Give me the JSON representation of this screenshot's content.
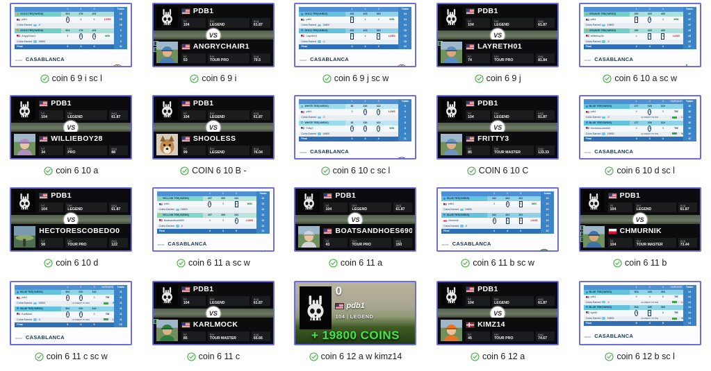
{
  "page": {
    "columns": 5,
    "rows": 4,
    "accent_border": "#6a6de2",
    "check_color": "#3aa93a"
  },
  "scorecard_common": {
    "room_label": "ROOM:",
    "room_name": "CASABLANCA",
    "prize_label": "PRIZE:",
    "prize_value": "19800",
    "final_label": "Final",
    "total_header": "Totals",
    "tee_label_suffix": "TEE(YARDS)",
    "coin_earned_label": "Coins Earned"
  },
  "cells": [
    {
      "id": "c1",
      "type": "scorecard",
      "caption": "coin 6 9 i sc l",
      "tee_color": "gold",
      "tee_name": "GOLD TEE(YARDS)",
      "holes": [
        "1",
        "2",
        "3",
        "4"
      ],
      "yardages": [
        "263",
        "278",
        "431"
      ],
      "total_header": "Totals",
      "rows": [
        {
          "player": "pdb1",
          "flag": "us",
          "scores": [
            "2",
            "4",
            "4"
          ],
          "marks": [
            "circ",
            "",
            ""
          ],
          "result": "LOSS",
          "total": "10",
          "coins": "-0"
        },
        {
          "player": "AngryChair1",
          "flag": "us",
          "scores": [
            "3",
            "3",
            "3"
          ],
          "marks": [
            "",
            "circ",
            "circ"
          ],
          "result": "WIN",
          "total": "9",
          "coins": "19800"
        }
      ],
      "par": [
        "3",
        "4",
        "4"
      ],
      "par_total": "11",
      "logo": "tree"
    },
    {
      "id": "c2",
      "type": "vs",
      "caption": "coin 6 9 i",
      "top": {
        "name": "PDB1",
        "flag": "us",
        "avatar": "skull",
        "stats": [
          {
            "k": "lvl",
            "v": "104"
          },
          {
            "k": "tier",
            "v": "LEGEND"
          },
          {
            "k": "avg",
            "v": "61.87"
          }
        ]
      },
      "bottom": {
        "name": "ANGRYCHAIR1",
        "flag": "us",
        "avatar": "golfer-blue",
        "badges": 2,
        "stats": [
          {
            "k": "lvl",
            "v": "53"
          },
          {
            "k": "tier",
            "v": "TOUR PRO"
          },
          {
            "k": "avg",
            "v": "79.5"
          }
        ]
      }
    },
    {
      "id": "c3",
      "type": "scorecard",
      "caption": "coin 6 9 j sc w",
      "tee_color": "blue",
      "tee_name": "GOLD TEE(YARDS)",
      "holes": [
        "1",
        "2",
        "3",
        "4"
      ],
      "yardages": [
        "432",
        "415",
        "369"
      ],
      "rows": [
        {
          "player": "pdb1",
          "flag": "us",
          "scores": [
            "5",
            "4",
            "4"
          ],
          "marks": [
            "sq",
            "",
            ""
          ],
          "result": "WIN",
          "total": "14",
          "coins": "19800"
        },
        {
          "player": "Layreth01",
          "flag": "us",
          "scores": [
            "5",
            "4",
            "6"
          ],
          "marks": [
            "sq",
            "",
            "sq"
          ],
          "result": "LOSS",
          "total": "15",
          "coins": "-0"
        }
      ],
      "par": [
        "4",
        "4",
        "4"
      ],
      "par_total": "12",
      "logo": "tree"
    },
    {
      "id": "c4",
      "type": "vs",
      "caption": "coin 6 9 j",
      "top": {
        "name": "PDB1",
        "flag": "us",
        "avatar": "skull",
        "stats": [
          {
            "k": "lvl",
            "v": "104"
          },
          {
            "k": "tier",
            "v": "LEGEND"
          },
          {
            "k": "avg",
            "v": "61.87"
          }
        ]
      },
      "bottom": {
        "name": "LAYRETH01",
        "flag": "us",
        "avatar": "golfer-cap",
        "badges": 1,
        "stats": [
          {
            "k": "lvl",
            "v": "74"
          },
          {
            "k": "tier",
            "v": "TOUR PRO"
          },
          {
            "k": "avg",
            "v": "81.84"
          }
        ]
      }
    },
    {
      "id": "c5",
      "type": "scorecard",
      "caption": "coin 6 10 a sc w",
      "tee_color": "orange",
      "tee_name": "ORANGE TEE(YARDS)",
      "holes": [
        "1",
        "2",
        "3",
        "4"
      ],
      "yardages": [
        "352",
        "425",
        "400"
      ],
      "rows": [
        {
          "player": "pdb1",
          "flag": "us",
          "scores": [
            "5",
            "3",
            "4"
          ],
          "marks": [
            "sq",
            "circ",
            ""
          ],
          "result": "WIN",
          "total": "12",
          "coins": "19800"
        },
        {
          "player": "WillieBoy28",
          "flag": "us",
          "scores": [
            "4",
            "6",
            "5"
          ],
          "marks": [
            "",
            "sq",
            "sq"
          ],
          "result": "LOSS",
          "total": "15",
          "coins": "-0"
        }
      ],
      "par": [
        "4",
        "4",
        "4"
      ],
      "par_total": "12",
      "logo": "pine"
    },
    {
      "id": "c6",
      "type": "vs",
      "caption": "coin 6 10 a",
      "top": {
        "name": "PDB1",
        "flag": "us",
        "avatar": "skull",
        "stats": [
          {
            "k": "lvl",
            "v": "104"
          },
          {
            "k": "tier",
            "v": "LEGEND"
          },
          {
            "k": "avg",
            "v": "61.87"
          }
        ]
      },
      "bottom": {
        "name": "WILLIEBOY28",
        "flag": "us",
        "avatar": "golfer-hat",
        "badges": 0,
        "stats": [
          {
            "k": "lvl",
            "v": "34"
          },
          {
            "k": "tier",
            "v": "PRO"
          },
          {
            "k": "avg",
            "v": "88"
          }
        ]
      }
    },
    {
      "id": "c7",
      "type": "vs",
      "caption": "COIN 6 10 B -",
      "top": {
        "name": "PDB1",
        "flag": "us",
        "avatar": "skull",
        "stats": [
          {
            "k": "lvl",
            "v": "104"
          },
          {
            "k": "tier",
            "v": "LEGEND"
          },
          {
            "k": "avg",
            "v": "61.87"
          }
        ]
      },
      "bottom": {
        "name": "SHOOLESS",
        "flag": "us",
        "avatar": "dog",
        "badges": 0,
        "stats": [
          {
            "k": "lvl",
            "v": "99"
          },
          {
            "k": "tier",
            "v": "LEGEND"
          },
          {
            "k": "avg",
            "v": "76.04"
          }
        ]
      }
    },
    {
      "id": "c8",
      "type": "scorecard",
      "caption": "coin 6 10 c sc l",
      "tee_color": "white",
      "tee_name": "WHITE TEE(YARDS)",
      "holes": [
        "1",
        "2",
        "3",
        "4"
      ],
      "yardages": [
        "36",
        "336",
        "422"
      ],
      "rows": [
        {
          "player": "pdb1",
          "flag": "us",
          "scores": [
            "3",
            "3",
            "3"
          ],
          "marks": [
            "",
            "circ",
            "circ"
          ],
          "result": "LOSS",
          "total": "9",
          "coins": "-0"
        },
        {
          "player": "Fritty3",
          "flag": "us",
          "scores": [
            "3",
            "3",
            "3"
          ],
          "marks": [
            "circ",
            "circ",
            "circ"
          ],
          "result": "WIN",
          "total": "8",
          "coins": "19800"
        }
      ],
      "par": [
        "3",
        "4",
        "4"
      ],
      "par_total": "11",
      "logo": "crossed"
    },
    {
      "id": "c9",
      "type": "vs",
      "caption": "COIN 6 10 C",
      "top": {
        "name": "PDB1",
        "flag": "us",
        "avatar": "skull",
        "stats": [
          {
            "k": "lvl",
            "v": "104"
          },
          {
            "k": "tier",
            "v": "LEGEND"
          },
          {
            "k": "avg",
            "v": "61.87"
          }
        ]
      },
      "bottom": {
        "name": "FRITTY3",
        "flag": "us",
        "avatar": "golfer-cap2",
        "badges": 0,
        "stats": [
          {
            "k": "lvl",
            "v": "85"
          },
          {
            "k": "tier",
            "v": "TOUR MASTER"
          },
          {
            "k": "avg",
            "v": "133.33"
          }
        ]
      }
    },
    {
      "id": "c10",
      "type": "scorecard",
      "caption": "coin 6 10 d sc l",
      "tee_color": "blue",
      "tee_name": "BLUE TEE(YARDS)",
      "holes": [
        "1",
        "2",
        "3",
        "4"
      ],
      "yardages": [
        "277",
        "300",
        "310"
      ],
      "yardage_header": "YARDAGE",
      "rows": [
        {
          "player": "pdb1",
          "flag": "us",
          "scores": [
            "4",
            "3",
            "3"
          ],
          "marks": [
            "",
            "circ",
            ""
          ],
          "result": "TIE",
          "total": "10",
          "coins": "-0",
          "dist": true,
          "dist_result": "LOSS"
        },
        {
          "player": "Hectorescobedo0",
          "flag": "us",
          "scores": [
            "4",
            "3",
            "3"
          ],
          "marks": [
            "",
            "circ",
            ""
          ],
          "result": "TIE",
          "total": "10",
          "coins": "19800",
          "dist": true,
          "dist_result": "WIN"
        }
      ],
      "par": [
        "4",
        "4",
        "3"
      ],
      "par_total": "11",
      "logo": "crest"
    },
    {
      "id": "c11",
      "type": "vs",
      "caption": "coin 6 10 d",
      "top": {
        "name": "PDB1",
        "flag": "us",
        "avatar": "skull",
        "stats": [
          {
            "k": "lvl",
            "v": "104"
          },
          {
            "k": "tier",
            "v": "LEGEND"
          },
          {
            "k": "avg",
            "v": "61.87"
          }
        ]
      },
      "bottom": {
        "name": "HECTORESCOBEDO0",
        "flag": "none",
        "avatar": "course",
        "badges": 0,
        "stats": [
          {
            "k": "lvl",
            "v": "58"
          },
          {
            "k": "tier",
            "v": "TOUR PRO"
          },
          {
            "k": "avg",
            "v": "122"
          }
        ]
      }
    },
    {
      "id": "c12",
      "type": "scorecard",
      "caption": "coin 6 11 a sc w",
      "tee_color": "yellow",
      "tee_name": "YELLOW TEE(YARDS)",
      "holes": [
        "1",
        "2",
        "3",
        "4"
      ],
      "yardages": [
        "407",
        "399",
        "344"
      ],
      "rows": [
        {
          "player": "pdb1",
          "flag": "us",
          "scores": [
            "3",
            "3",
            "6"
          ],
          "marks": [
            "circ",
            "",
            "sq"
          ],
          "result": "WIN",
          "total": "13",
          "coins": "19800"
        },
        {
          "player": "Boatsandhoes690",
          "flag": "us",
          "scores": [
            "4",
            "3",
            "4"
          ],
          "marks": [
            "",
            "",
            "circ"
          ],
          "result": "LOSS",
          "total": "13",
          "coins": "-0"
        }
      ],
      "par": [
        "4",
        "3",
        "5"
      ],
      "par_total": "12",
      "logo": "churchill"
    },
    {
      "id": "c13",
      "type": "vs",
      "caption": "coin 6 11 a",
      "top": {
        "name": "PDB1",
        "flag": "us",
        "avatar": "skull",
        "stats": [
          {
            "k": "lvl",
            "v": "104"
          },
          {
            "k": "tier",
            "v": "LEGEND"
          },
          {
            "k": "avg",
            "v": "61.87"
          }
        ]
      },
      "bottom": {
        "name": "BOATSANDHOES690",
        "flag": "us",
        "avatar": "golfer-visor",
        "badges": 0,
        "stats": [
          {
            "k": "lvl",
            "v": "43"
          },
          {
            "k": "tier",
            "v": "TOUR PRO"
          },
          {
            "k": "avg",
            "v": "150"
          }
        ]
      }
    },
    {
      "id": "c14",
      "type": "scorecard",
      "caption": "coin 6 11 b sc w",
      "tee_color": "blue",
      "tee_name": "BLUE TEE(YARDS)",
      "holes": [
        "1",
        "2",
        "3",
        "4"
      ],
      "yardages": [
        "342",
        "404",
        "402"
      ],
      "rows": [
        {
          "player": "pdb1",
          "flag": "us",
          "scores": [
            "4",
            "3",
            "5"
          ],
          "marks": [
            "",
            "circ",
            "sq"
          ],
          "result": "WIN",
          "total": "12",
          "coins": "19800"
        },
        {
          "player": "chmurnik",
          "flag": "pl",
          "scores": [
            "3",
            "5",
            "5"
          ],
          "marks": [
            "circ",
            "sq",
            "sq"
          ],
          "result": "LOSS",
          "total": "13",
          "coins": "-0"
        }
      ],
      "par": [
        "4",
        "4",
        "4"
      ],
      "par_total": "12",
      "logo": "c-crest"
    },
    {
      "id": "c15",
      "type": "vs",
      "caption": "coin 6 11 b",
      "top": {
        "name": "PDB1",
        "flag": "us",
        "avatar": "skull",
        "stats": [
          {
            "k": "lvl",
            "v": "104"
          },
          {
            "k": "tier",
            "v": "LEGEND"
          },
          {
            "k": "avg",
            "v": "61.87"
          }
        ]
      },
      "bottom": {
        "name": "CHMURNIK",
        "flag": "pl",
        "avatar": "golfer-blue2",
        "badges": 3,
        "stats": [
          {
            "k": "lvl",
            "v": "104"
          },
          {
            "k": "tier",
            "v": "TOUR MASTER"
          },
          {
            "k": "avg",
            "v": "73.44"
          }
        ]
      }
    },
    {
      "id": "c16",
      "type": "scorecard",
      "caption": "coin 6 11 c sc w",
      "tee_color": "blue",
      "tee_name": "BLUE TEE(YARDS)",
      "holes": [
        "1",
        "2",
        "3",
        "4"
      ],
      "yardages": [
        "504",
        "200",
        "310"
      ],
      "yardage_header": "YARDAGE",
      "rows": [
        {
          "player": "pdb1",
          "flag": "us",
          "scores": [
            "4",
            "3",
            "3"
          ],
          "marks": [
            "circ",
            "circ",
            ""
          ],
          "result": "TIE",
          "total": "11",
          "coins": "19800",
          "dist": true,
          "dist_result": "WIN"
        },
        {
          "player": "KarlMock",
          "flag": "us",
          "scores": [
            "4",
            "3",
            "3"
          ],
          "marks": [
            "circ",
            "circ",
            ""
          ],
          "result": "TIE",
          "total": "11",
          "coins": "-0",
          "dist": true,
          "dist_result": "LOSS"
        }
      ],
      "par": [
        "5",
        "4",
        "3"
      ],
      "par_total": "12",
      "logo": "crest"
    },
    {
      "id": "c17",
      "type": "vs",
      "caption": "coin 6 11 c",
      "top": {
        "name": "PDB1",
        "flag": "us",
        "avatar": "skull",
        "stats": [
          {
            "k": "lvl",
            "v": "104"
          },
          {
            "k": "tier",
            "v": "LEGEND"
          },
          {
            "k": "avg",
            "v": "61.87"
          }
        ]
      },
      "bottom": {
        "name": "KARLMOCK",
        "flag": "us",
        "avatar": "golfer-green",
        "badges": 1,
        "stats": [
          {
            "k": "lvl",
            "v": "85"
          },
          {
            "k": "tier",
            "v": "TOUR MASTER"
          },
          {
            "k": "avg",
            "v": "65.66"
          }
        ]
      }
    },
    {
      "id": "c18",
      "type": "coinwin",
      "caption": "coin 6 12 a w kimz14",
      "score": "0",
      "player": "pdb1",
      "flag": "us",
      "level": "104",
      "tier": "LEGEND",
      "coins_text": "+ 19800 COINS"
    },
    {
      "id": "c19",
      "type": "vs",
      "caption": "coin 6 12 a",
      "top": {
        "name": "PDB1",
        "flag": "us",
        "avatar": "skull",
        "stats": [
          {
            "k": "lvl",
            "v": "104"
          },
          {
            "k": "tier",
            "v": "LEGEND"
          },
          {
            "k": "avg",
            "v": "61.87"
          }
        ]
      },
      "bottom": {
        "name": "KIMZ14",
        "flag": "dk",
        "avatar": "golfer-orange",
        "badges": 0,
        "stats": [
          {
            "k": "lvl",
            "v": "45"
          },
          {
            "k": "tier",
            "v": "TOUR PRO"
          },
          {
            "k": "avg",
            "v": "74.67"
          }
        ]
      }
    },
    {
      "id": "c20",
      "type": "scorecard",
      "caption": "coin 6 12 b sc l",
      "tee_color": "blue",
      "tee_name": "BLUE TEE(YARDS)",
      "holes": [
        "1",
        "2",
        "3",
        "4"
      ],
      "yardages": [
        "504",
        "435",
        "465"
      ],
      "yardage_header": "YARDAGE",
      "rows": [
        {
          "player": "pdb1",
          "flag": "us",
          "scores": [
            "5",
            "4",
            "5"
          ],
          "marks": [
            "",
            "",
            ""
          ],
          "result": "TIE",
          "total": "14",
          "coins": "-0",
          "dist": true,
          "dist_result": "LOSS"
        },
        {
          "player": "kyn50",
          "flag": "us",
          "scores": [
            "3",
            "6",
            "5"
          ],
          "marks": [
            "circ",
            "sq",
            ""
          ],
          "result": "TIE",
          "total": "14",
          "coins": "19800",
          "dist": true,
          "dist_result": "WIN"
        }
      ],
      "par": [
        "5",
        "4",
        "5"
      ],
      "par_total": "14",
      "logo": "crest"
    }
  ]
}
